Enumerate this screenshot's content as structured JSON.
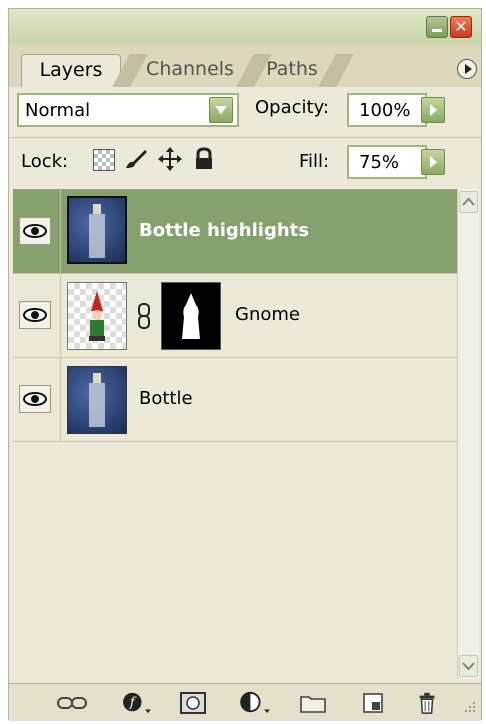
{
  "window": {
    "close_glyph": "✕"
  },
  "tabs": [
    {
      "label": "Layers",
      "active": true
    },
    {
      "label": "Channels",
      "active": false
    },
    {
      "label": "Paths",
      "active": false
    }
  ],
  "blend_mode": {
    "value": "Normal"
  },
  "opacity": {
    "label": "Opacity:",
    "value": "100%"
  },
  "lock": {
    "label": "Lock:",
    "icons": [
      "lock-transparency-icon",
      "lock-image-brush-icon",
      "lock-position-move-icon",
      "lock-all-padlock-icon"
    ]
  },
  "fill": {
    "label": "Fill:",
    "value": "75%"
  },
  "layers": [
    {
      "name": "Bottle highlights",
      "selected": true,
      "visible": true
    },
    {
      "name": "Gnome",
      "selected": false,
      "visible": true,
      "has_mask": true
    },
    {
      "name": "Bottle",
      "selected": false,
      "visible": true
    }
  ],
  "bottom_toolbar": [
    "link-layers-icon",
    "layer-style-icon",
    "add-mask-icon",
    "adjustment-layer-icon",
    "new-group-folder-icon",
    "new-layer-icon",
    "delete-trash-icon"
  ],
  "colors": {
    "selected_row": "#87a16e",
    "panel_bg": "#ece9d8",
    "accent_button": "#8aa963"
  }
}
